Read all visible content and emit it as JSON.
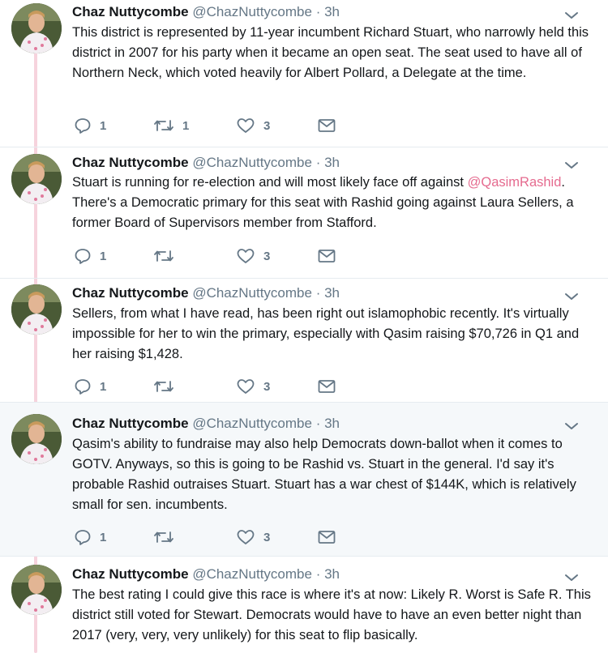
{
  "tweets": [
    {
      "name": "Chaz Nuttycombe",
      "handle": "@ChazNuttycombe",
      "time": "· 3h",
      "text_a": "This district is represented by 11-year incumbent Richard Stuart, who narrowly held this district in 2007 for his party when it became an open seat. The seat used to have all of Northern Neck, which voted heavily for Albert Pollard, a Delegate at the time.",
      "mention": "",
      "text_b": "",
      "replies": "1",
      "retweets": "1",
      "likes": "3"
    },
    {
      "name": "Chaz Nuttycombe",
      "handle": "@ChazNuttycombe",
      "time": "· 3h",
      "text_a": "Stuart is running for re-election and will most likely face off against ",
      "mention": "@QasimRashid",
      "text_b": ". There's a Democratic primary for this seat with Rashid going against Laura Sellers, a former Board of Supervisors member from Stafford.",
      "replies": "1",
      "retweets": "",
      "likes": "3"
    },
    {
      "name": "Chaz Nuttycombe",
      "handle": "@ChazNuttycombe",
      "time": "· 3h",
      "text_a": "Sellers, from what I have read, has been right out islamophobic recently. It's virtually impossible for her to win the primary, especially with Qasim raising $70,726 in Q1 and her raising $1,428.",
      "mention": "",
      "text_b": "",
      "replies": "1",
      "retweets": "",
      "likes": "3"
    },
    {
      "name": "Chaz Nuttycombe",
      "handle": "@ChazNuttycombe",
      "time": "· 3h",
      "text_a": "Qasim's ability to fundraise may also help Democrats down-ballot when it comes to GOTV. Anyways, so this is going to be Rashid vs. Stuart in the general. I'd say it's probable Rashid outraises Stuart. Stuart has a war chest of $144K, which is relatively small for sen. incumbents.",
      "mention": "",
      "text_b": "",
      "replies": "1",
      "retweets": "",
      "likes": "3"
    },
    {
      "name": "Chaz Nuttycombe",
      "handle": "@ChazNuttycombe",
      "time": "· 3h",
      "text_a": "The best rating I could give this race is where it's at now: Likely R. Worst is Safe R. This district still voted for Stewart. Democrats would have to have an even better night than 2017 (very, very, very unlikely) for this seat to flip basically.",
      "mention": "",
      "text_b": "",
      "replies": "",
      "retweets": "",
      "likes": ""
    }
  ],
  "icons": {
    "reply": "reply-icon",
    "retweet": "retweet-icon",
    "like": "heart-icon",
    "dm": "envelope-icon",
    "caret": "chevron-down-icon"
  },
  "colors": {
    "mention": "#e56b8f",
    "thread_line": "#f6d3dd",
    "icon_gray": "#657786",
    "highlight_bg": "#f5f8fa"
  }
}
